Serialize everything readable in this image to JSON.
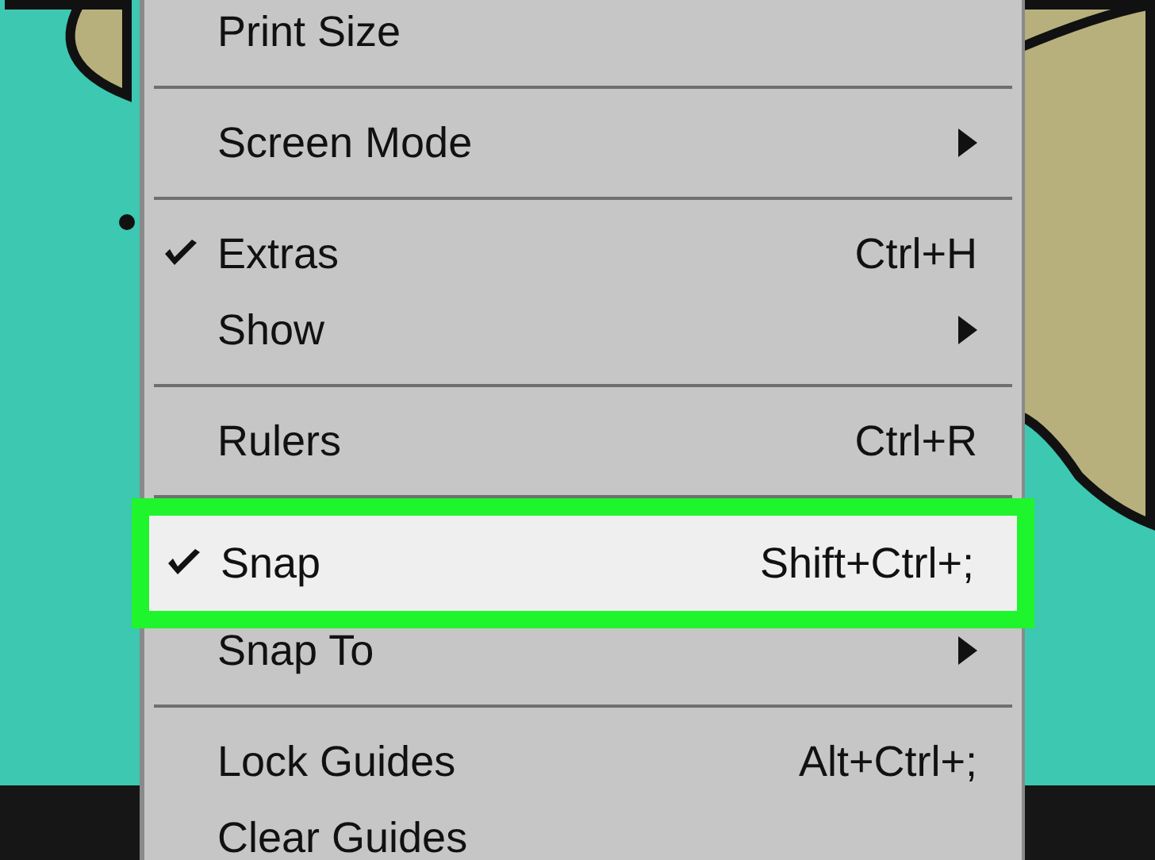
{
  "menu": {
    "items": [
      {
        "kind": "item",
        "label": "Print Size",
        "checked": false,
        "submenu": false,
        "selected": false
      },
      {
        "kind": "separator"
      },
      {
        "kind": "item",
        "label": "Screen Mode",
        "checked": false,
        "submenu": true,
        "selected": false
      },
      {
        "kind": "separator"
      },
      {
        "kind": "item",
        "label": "Extras",
        "shortcut": "Ctrl+H",
        "checked": true,
        "submenu": false,
        "selected": false
      },
      {
        "kind": "item",
        "label": "Show",
        "checked": false,
        "submenu": true,
        "selected": false
      },
      {
        "kind": "separator"
      },
      {
        "kind": "item",
        "label": "Rulers",
        "shortcut": "Ctrl+R",
        "checked": false,
        "submenu": false,
        "selected": false
      },
      {
        "kind": "separator"
      },
      {
        "kind": "item",
        "label": "Snap",
        "shortcut": "Shift+Ctrl+;",
        "checked": true,
        "submenu": false,
        "selected": true
      },
      {
        "kind": "item",
        "label": "Snap To",
        "checked": false,
        "submenu": true,
        "selected": false
      },
      {
        "kind": "separator"
      },
      {
        "kind": "item",
        "label": "Lock Guides",
        "shortcut": "Alt+Ctrl+;",
        "checked": false,
        "submenu": false,
        "selected": false
      },
      {
        "kind": "item",
        "label": "Clear Guides",
        "checked": false,
        "submenu": false,
        "selected": false
      }
    ]
  }
}
